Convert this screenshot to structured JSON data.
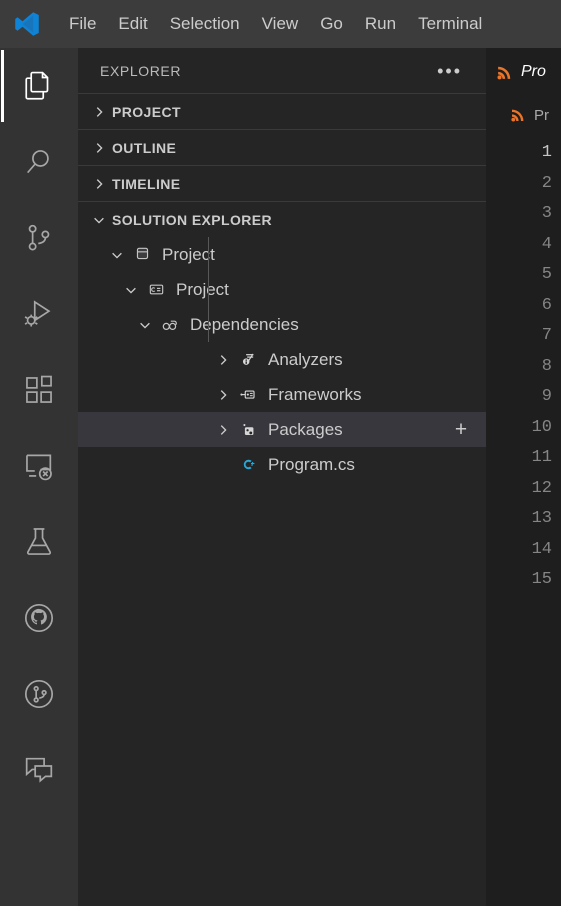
{
  "window": {
    "app": "Visual Studio Code",
    "logo_icon": "vscode-logo"
  },
  "menubar": {
    "items": [
      {
        "label": "File"
      },
      {
        "label": "Edit"
      },
      {
        "label": "Selection"
      },
      {
        "label": "View"
      },
      {
        "label": "Go"
      },
      {
        "label": "Run"
      },
      {
        "label": "Terminal"
      }
    ]
  },
  "activitybar": {
    "items": [
      {
        "name": "explorer",
        "icon": "files-icon",
        "active": true
      },
      {
        "name": "search",
        "icon": "search-icon",
        "active": false
      },
      {
        "name": "source-control",
        "icon": "source-control-icon",
        "active": false
      },
      {
        "name": "run-and-debug",
        "icon": "run-debug-icon",
        "active": false
      },
      {
        "name": "extensions",
        "icon": "extensions-icon",
        "active": false
      },
      {
        "name": "remote-explorer",
        "icon": "remote-explorer-icon",
        "active": false
      },
      {
        "name": "testing",
        "icon": "beaker-icon",
        "active": false
      },
      {
        "name": "github",
        "icon": "github-icon",
        "active": false
      },
      {
        "name": "gitlens",
        "icon": "gitlens-icon",
        "active": false
      },
      {
        "name": "chat",
        "icon": "chat-icon",
        "active": false
      }
    ]
  },
  "sidebar": {
    "title": "EXPLORER",
    "more_actions_icon": "ellipsis-icon",
    "sections": [
      {
        "label": "PROJECT",
        "expanded": false
      },
      {
        "label": "OUTLINE",
        "expanded": false
      },
      {
        "label": "TIMELINE",
        "expanded": false
      },
      {
        "label": "SOLUTION EXPLORER",
        "expanded": true
      }
    ],
    "tree": [
      {
        "label": "Project",
        "icon": "solution-icon",
        "expanded": true,
        "depth": 1,
        "selected": false
      },
      {
        "label": "Project",
        "icon": "csharp-project-icon",
        "expanded": true,
        "depth": 2,
        "selected": false
      },
      {
        "label": "Dependencies",
        "icon": "dependencies-icon",
        "expanded": true,
        "depth": 3,
        "selected": false
      },
      {
        "label": "Analyzers",
        "icon": "analyzers-icon",
        "expanded": false,
        "depth": 4,
        "selected": false
      },
      {
        "label": "Frameworks",
        "icon": "frameworks-icon",
        "expanded": false,
        "depth": 4,
        "selected": false
      },
      {
        "label": "Packages",
        "icon": "packages-icon",
        "expanded": false,
        "depth": 4,
        "selected": true,
        "action": "+"
      },
      {
        "label": "Program.cs",
        "icon": "csharp-file-icon",
        "depth": 4,
        "leaf": true,
        "selected": false
      }
    ]
  },
  "editor": {
    "tab": {
      "label": "Pro",
      "icon": "rss-icon",
      "preview": true
    },
    "breadcrumb": {
      "label": "Pr",
      "icon": "rss-icon"
    },
    "line_numbers": [
      "1",
      "2",
      "3",
      "4",
      "5",
      "6",
      "7",
      "8",
      "9",
      "10",
      "11",
      "12",
      "13",
      "14",
      "15"
    ],
    "active_line": "1"
  },
  "colors": {
    "menubar_bg": "#3c3c3c",
    "activitybar_bg": "#333333",
    "sidebar_bg": "#252526",
    "editor_bg": "#1e1e1e",
    "selected_row_bg": "#37373d",
    "foreground": "#cccccc",
    "accent_blue": "#0078d4",
    "rss_orange": "#e8752b",
    "csharp_blue": "#2ba7d6"
  }
}
